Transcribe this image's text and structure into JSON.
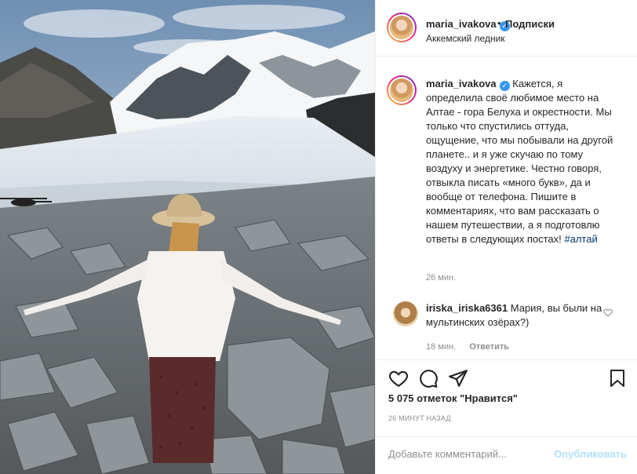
{
  "header": {
    "username": "maria_ivakova",
    "verified_mark": "✓",
    "separator": "•",
    "follow_label": "Подписки",
    "location": "Аккемский ледник"
  },
  "caption": {
    "username": "maria_ivakova",
    "text": "Кажется, я определила своё любимое место на Алтае - гора Белуха и окрестности. Мы только что спустились оттуда, ощущение, что мы побывали на другой планете.. и я уже скучаю по тому воздуху и энергетике. Честно говоря, отвыкла писать «много букв», да и вообще от телефона. Пишите в комментариях, что вам рассказать о нашем путешествии, а я подготовлю ответы в следующих постах!",
    "hashtag": "#алтай",
    "time": "26 мин."
  },
  "comment": {
    "username": "iriska_iriska6361",
    "text": "Мария, вы были на мультинских озёрах?)",
    "time": "18 мин.",
    "reply_label": "Ответить"
  },
  "icons": {
    "like": "heart-icon",
    "comment": "comment-icon",
    "share": "share-icon",
    "save": "bookmark-icon"
  },
  "stats": {
    "likes_count": "5 075",
    "likes_text": "отметок \"Нравится\"",
    "posted_ago": "26 минут назад"
  },
  "add_comment": {
    "placeholder": "Добавьте комментарий...",
    "publish_label": "Опубликовать"
  },
  "colors": {
    "link": "#00376b",
    "verified": "#3897f0",
    "publish_disabled": "#b2dffc",
    "muted": "#8e8e8e"
  }
}
